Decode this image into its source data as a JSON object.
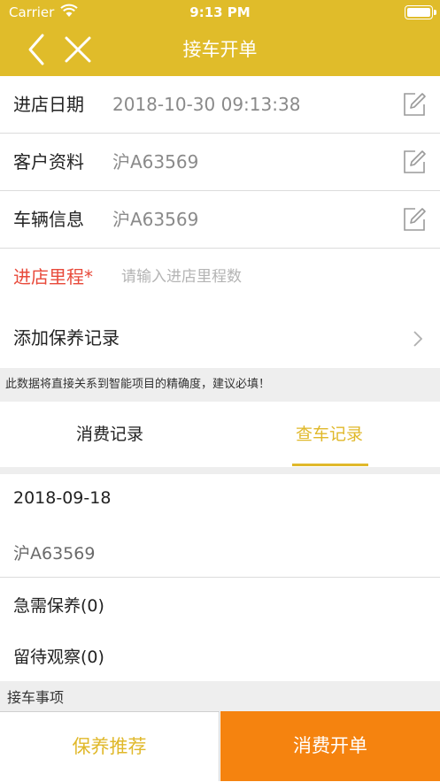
{
  "status_bar": {
    "carrier": "Carrier",
    "time": "9:13 PM"
  },
  "nav": {
    "title": "接车开单",
    "back_icon": "chevron-left-icon",
    "close_icon": "close-icon"
  },
  "form": {
    "visit_date": {
      "label": "进店日期",
      "value": "2018-10-30 09:13:38"
    },
    "customer": {
      "label": "客户资料",
      "value": "沪A63569"
    },
    "vehicle": {
      "label": "车辆信息",
      "value": "沪A63569"
    },
    "mileage": {
      "label": "进店里程*",
      "placeholder": "请输入进店里程数"
    },
    "maintenance": {
      "label": "添加保养记录"
    }
  },
  "notice": "此数据将直接关系到智能项目的精确度，建议必填！",
  "tabs": [
    {
      "label": "消费记录",
      "active": false
    },
    {
      "label": "查车记录",
      "active": true
    }
  ],
  "record": {
    "date": "2018-09-18",
    "plate": "沪A63569",
    "urgent": "急需保养(0)",
    "observe": "留待观察(0)"
  },
  "section_title": "接车事项",
  "buttons": {
    "recommend": "保养推荐",
    "order": "消费开单"
  },
  "colors": {
    "accent": "#e0bc2a",
    "orange": "#f5830f",
    "required": "#e8493a"
  }
}
